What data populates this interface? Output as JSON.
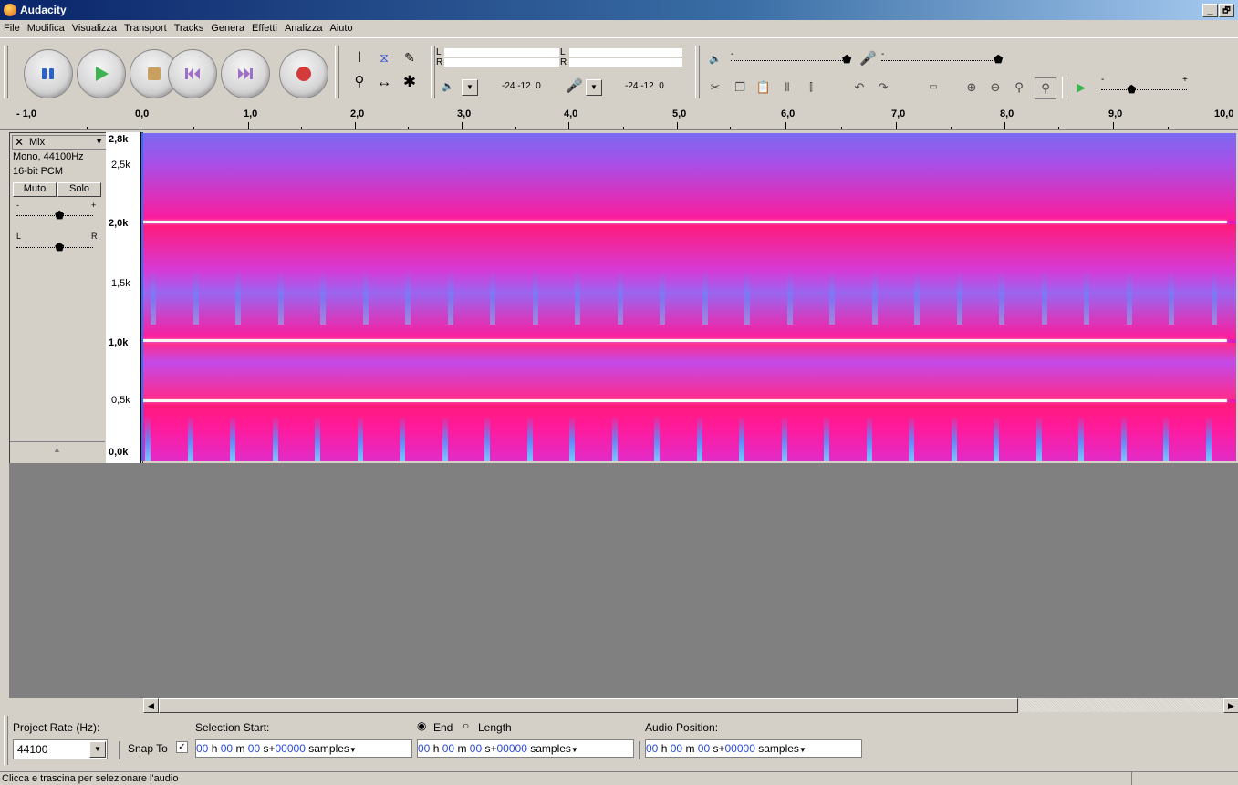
{
  "window": {
    "title": "Audacity",
    "minimize": "_",
    "restore": "🗗"
  },
  "menu": [
    "File",
    "Modifica",
    "Visualizza",
    "Transport",
    "Tracks",
    "Genera",
    "Effetti",
    "Analizza",
    "Aiuto"
  ],
  "meters": {
    "play_ch_left": "L",
    "play_ch_right": "R",
    "rec_ch_left": "L",
    "rec_ch_right": "R",
    "play_scale": "-24 -12  0",
    "rec_scale": "-24 -12  0"
  },
  "mixer": {
    "minus": "-",
    "plus": "+"
  },
  "ruler": {
    "labels": [
      "- 1,0",
      "0,0",
      "1,0",
      "2,0",
      "3,0",
      "4,0",
      "5,0",
      "6,0",
      "7,0",
      "8,0",
      "9,0",
      "10,0"
    ]
  },
  "track": {
    "name": "Mix",
    "info_line1": "Mono, 44100Hz",
    "info_line2": "16-bit PCM",
    "mute_label": "Muto",
    "solo_label": "Solo",
    "gain_min": "-",
    "gain_max": "+",
    "pan_left": "L",
    "pan_right": "R",
    "scale_labels": [
      "2,8k",
      "2,5k",
      "2,0k",
      "1,5k",
      "1,0k",
      "0,5k",
      "0,0k"
    ]
  },
  "selection_bar": {
    "project_rate_label": "Project Rate (Hz):",
    "project_rate_value": "44100",
    "snap_to_label": "Snap To",
    "selection_start_label": "Selection Start:",
    "end_label": "End",
    "length_label": "Length",
    "audio_position_label": "Audio Position:",
    "time_hh": "00",
    "time_h": "h",
    "time_mm": "00",
    "time_m": "m",
    "time_ss": "00",
    "time_s": "s+",
    "time_samples": "00000",
    "time_unit": "samples"
  },
  "status": {
    "text": "Clicca e trascina per selezionare l'audio"
  },
  "colors": {
    "spectrogram_pink": "#ff1a9a",
    "spectrogram_blue": "#6aa0ff",
    "title_bar": "#0a246a"
  }
}
